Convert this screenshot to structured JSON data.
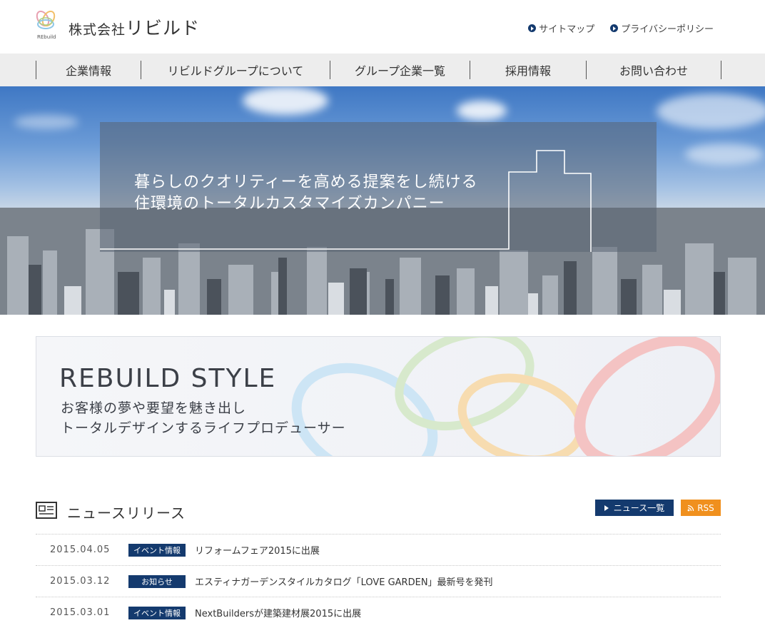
{
  "header": {
    "logo_mark_text": "REbuild",
    "company_prefix": "株式会社",
    "company_name": "リビルド",
    "util_links": [
      {
        "label": "サイトマップ"
      },
      {
        "label": "プライバシーポリシー"
      }
    ]
  },
  "nav": {
    "items": [
      {
        "label": "企業情報"
      },
      {
        "label": "リビルドグループについて"
      },
      {
        "label": "グループ企業一覧"
      },
      {
        "label": "採用情報"
      },
      {
        "label": "お問い合わせ"
      }
    ]
  },
  "hero": {
    "line1": "暮らしのクオリティーを高める提案をし続ける",
    "line2": "住環境のトータルカスタマイズカンパニー"
  },
  "style_banner": {
    "title": "REBUILD STYLE",
    "line1": "お客様の夢や要望を魅き出し",
    "line2": "トータルデザインするライフプロデューサー"
  },
  "news": {
    "title": "ニュースリリース",
    "list_button": "ニュース一覧",
    "rss_button": "RSS",
    "items": [
      {
        "date": "2015.04.05",
        "category": "イベント情報",
        "text": "リフォームフェア2015に出展"
      },
      {
        "date": "2015.03.12",
        "category": "お知らせ",
        "text": "エスティナガーデンスタイルカタログ「LOVE GARDEN」最新号を発刊"
      },
      {
        "date": "2015.03.01",
        "category": "イベント情報",
        "text": "NextBuildersが建築建材展2015に出展"
      }
    ]
  },
  "colors": {
    "navy": "#143a6e",
    "rss_orange": "#f0901e",
    "nav_bg": "#ededed"
  }
}
